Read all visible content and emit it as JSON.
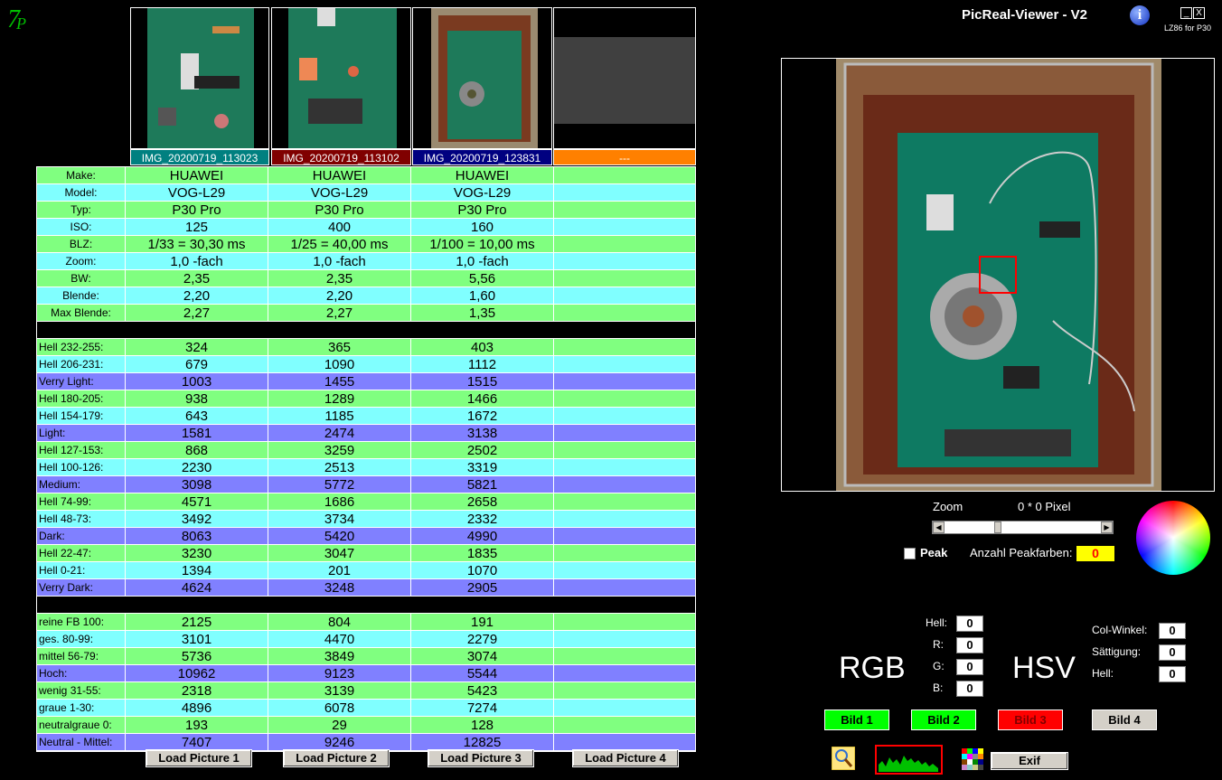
{
  "window": {
    "title": "PicReal-Viewer - V2",
    "subtitle": "LZ86 for P30",
    "minimize_label": "_",
    "close_label": "X",
    "info_label": "i"
  },
  "thumbnails": [
    {
      "name": "IMG_20200719_113023",
      "color": "#008080"
    },
    {
      "name": "IMG_20200719_113102",
      "color": "#800000"
    },
    {
      "name": "IMG_20200719_123831",
      "color": "#000080"
    },
    {
      "name": "---",
      "color": "#ff8000"
    }
  ],
  "exif_rows": [
    {
      "label": "Make:",
      "values": [
        "HUAWEI",
        "HUAWEI",
        "HUAWEI",
        ""
      ]
    },
    {
      "label": "Model:",
      "values": [
        "VOG-L29",
        "VOG-L29",
        "VOG-L29",
        ""
      ]
    },
    {
      "label": "Typ:",
      "values": [
        "P30 Pro",
        "P30 Pro",
        "P30 Pro",
        ""
      ]
    },
    {
      "label": "ISO:",
      "values": [
        "125",
        "400",
        "160",
        ""
      ]
    },
    {
      "label": "BLZ:",
      "values": [
        "1/33 = 30,30 ms",
        "1/25 = 40,00 ms",
        "1/100 = 10,00 ms",
        ""
      ]
    },
    {
      "label": "Zoom:",
      "values": [
        "1,0 -fach",
        "1,0 -fach",
        "1,0 -fach",
        ""
      ]
    },
    {
      "label": "BW:",
      "values": [
        "2,35",
        "2,35",
        "5,56",
        ""
      ]
    },
    {
      "label": "Blende:",
      "values": [
        "2,20",
        "2,20",
        "1,60",
        ""
      ]
    },
    {
      "label": "Max Blende:",
      "values": [
        "2,27",
        "2,27",
        "1,35",
        ""
      ]
    }
  ],
  "hell_rows": [
    {
      "label": "Hell 232-255:",
      "values": [
        "324",
        "365",
        "403",
        ""
      ]
    },
    {
      "label": "Hell 206-231:",
      "values": [
        "679",
        "1090",
        "1112",
        ""
      ]
    },
    {
      "label": "Verry Light:",
      "values": [
        "1003",
        "1455",
        "1515",
        ""
      ]
    },
    {
      "label": "Hell 180-205:",
      "values": [
        "938",
        "1289",
        "1466",
        ""
      ]
    },
    {
      "label": "Hell 154-179:",
      "values": [
        "643",
        "1185",
        "1672",
        ""
      ]
    },
    {
      "label": "Light:",
      "values": [
        "1581",
        "2474",
        "3138",
        ""
      ]
    },
    {
      "label": "Hell 127-153:",
      "values": [
        "868",
        "3259",
        "2502",
        ""
      ]
    },
    {
      "label": "Hell 100-126:",
      "values": [
        "2230",
        "2513",
        "3319",
        ""
      ]
    },
    {
      "label": "Medium:",
      "values": [
        "3098",
        "5772",
        "5821",
        ""
      ]
    },
    {
      "label": "Hell 74-99:",
      "values": [
        "4571",
        "1686",
        "2658",
        ""
      ]
    },
    {
      "label": "Hell 48-73:",
      "values": [
        "3492",
        "3734",
        "2332",
        ""
      ]
    },
    {
      "label": "Dark:",
      "values": [
        "8063",
        "5420",
        "4990",
        ""
      ]
    },
    {
      "label": "Hell 22-47:",
      "values": [
        "3230",
        "3047",
        "1835",
        ""
      ]
    },
    {
      "label": "Hell 0-21:",
      "values": [
        "1394",
        "201",
        "1070",
        ""
      ]
    },
    {
      "label": "Verry Dark:",
      "values": [
        "4624",
        "3248",
        "2905",
        ""
      ]
    }
  ],
  "color_rows": [
    {
      "label": "reine FB 100:",
      "values": [
        "2125",
        "804",
        "191",
        ""
      ]
    },
    {
      "label": "ges. 80-99:",
      "values": [
        "3101",
        "4470",
        "2279",
        ""
      ]
    },
    {
      "label": "mittel 56-79:",
      "values": [
        "5736",
        "3849",
        "3074",
        ""
      ]
    },
    {
      "label": "Hoch:",
      "values": [
        "10962",
        "9123",
        "5544",
        ""
      ]
    },
    {
      "label": "wenig 31-55:",
      "values": [
        "2318",
        "3139",
        "5423",
        ""
      ]
    },
    {
      "label": "graue  1-30:",
      "values": [
        "4896",
        "6078",
        "7274",
        ""
      ]
    },
    {
      "label": "neutralgraue 0:",
      "values": [
        "193",
        "29",
        "128",
        ""
      ]
    },
    {
      "label": "Neutral - Mittel:",
      "values": [
        "7407",
        "9246",
        "12825",
        ""
      ]
    }
  ],
  "load_buttons": [
    "Load Picture 1",
    "Load Picture 2",
    "Load Picture 3",
    "Load Picture 4"
  ],
  "zoom": {
    "label": "Zoom",
    "pixel_text": "0 * 0 Pixel"
  },
  "peak": {
    "label": "Peak",
    "count_label": "Anzahl Peakfarben:",
    "count": "0",
    "checked": false
  },
  "rgb": {
    "title": "RGB",
    "hell_label": "Hell:",
    "r_label": "R:",
    "g_label": "G:",
    "b_label": "B:",
    "hell": "0",
    "r": "0",
    "g": "0",
    "b": "0"
  },
  "hsv": {
    "title": "HSV",
    "winkel_label": "Col-Winkel:",
    "saett_label": "Sättigung:",
    "hell_label": "Hell:",
    "winkel": "0",
    "saett": "0",
    "hell": "0"
  },
  "bild_buttons": [
    {
      "label": "Bild 1",
      "color": "#00ff00"
    },
    {
      "label": "Bild 2",
      "color": "#00ff00"
    },
    {
      "label": "Bild 3",
      "color": "#ff0000"
    },
    {
      "label": "Bild 4",
      "color": "#d4d0c8"
    }
  ],
  "exif_button": "Exif",
  "icons": [
    "logo-icon",
    "info-icon",
    "magnifier-icon",
    "histogram-icon",
    "palette-icon",
    "color-wheel-icon"
  ]
}
